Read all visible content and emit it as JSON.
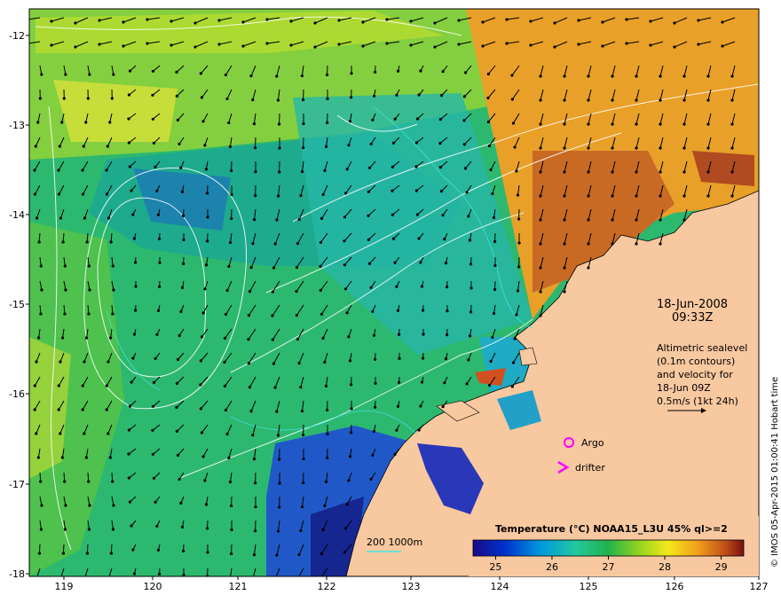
{
  "x_ticks": [
    "119",
    "120",
    "121",
    "122",
    "123",
    "124",
    "125",
    "126",
    "127"
  ],
  "y_ticks": [
    "-12",
    "-13",
    "-14",
    "-15",
    "-16",
    "-17",
    "-18"
  ],
  "datetime": {
    "date": "18-Jun-2008",
    "time": "09:33Z"
  },
  "altimetry_note": [
    "Altimetric sealevel",
    "(0.1m contours)",
    "and velocity for",
    "18-Jun 09Z",
    "0.5m/s (1kt 24h)"
  ],
  "legend": {
    "argo": "Argo",
    "drifter": "drifter",
    "marker_color": "#ff00ff"
  },
  "bathymetry": "200  1000m",
  "colorbar": {
    "title": "Temperature (°C) NOAA15_L3U 45% ql>=2",
    "ticks": [
      "25",
      "26",
      "27",
      "28",
      "29"
    ],
    "min": 24.6,
    "max": 29.4
  },
  "copyright": "© IMOS 05-Apr-2015 01:00:41 Hobart time",
  "colors": {
    "land": "#f8c8a0",
    "ocean_mid": "#2db870",
    "vector": "#000000"
  }
}
